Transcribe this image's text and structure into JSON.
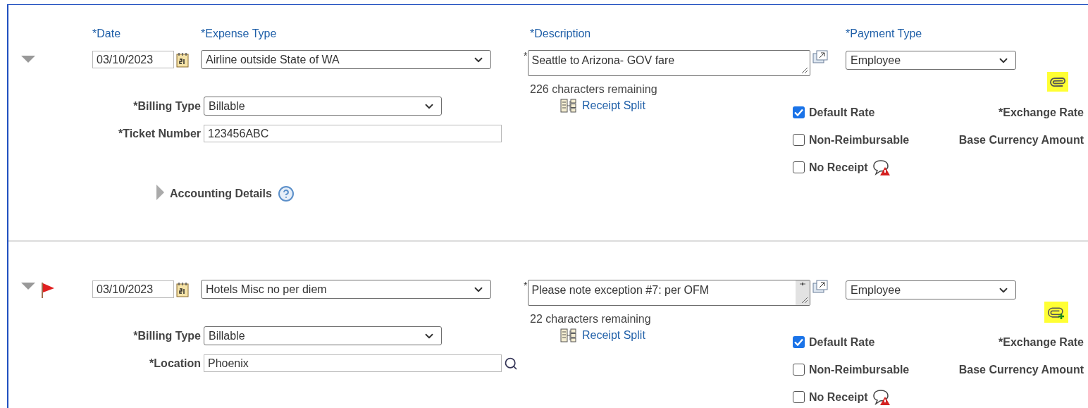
{
  "entries": [
    {
      "expanded": true,
      "flagged": false,
      "labels": {
        "date": "*Date",
        "expense_type": "*Expense Type",
        "description": "*Description",
        "payment_type": "*Payment Type"
      },
      "date": "03/10/2023",
      "expense_type": "Airline outside State of WA",
      "description_marker": "*",
      "description": "Seattle to Arizona- GOV fare",
      "description_scrollbar": false,
      "payment_type": "Employee",
      "attachment": {
        "kind": "attached"
      },
      "chars_remaining": "226 characters remaining",
      "receipt_split": "Receipt Split",
      "fields": [
        {
          "kind": "select",
          "label": "*Billing Type",
          "value": "Billable"
        },
        {
          "kind": "text",
          "label": "*Ticket Number",
          "value": "123456ABC"
        }
      ],
      "accounting_details": {
        "label": "Accounting Details",
        "expanded": false
      },
      "checkboxes": [
        {
          "label": "Default Rate",
          "checked": true,
          "side_label": "*Exchange Rate"
        },
        {
          "label": "Non-Reimbursable",
          "checked": false,
          "side_label": "Base Currency Amount"
        },
        {
          "label": "No Receipt",
          "checked": false,
          "warning": true
        }
      ]
    },
    {
      "expanded": true,
      "flagged": true,
      "date": "03/10/2023",
      "expense_type": "Hotels Misc no per diem",
      "description_marker": "*",
      "description": "Please note exception #7: per OFM",
      "description_scrollbar": true,
      "payment_type": "Employee",
      "attachment": {
        "kind": "add"
      },
      "chars_remaining": "22 characters remaining",
      "receipt_split": "Receipt Split",
      "fields": [
        {
          "kind": "select",
          "label": "*Billing Type",
          "value": "Billable"
        },
        {
          "kind": "lookup",
          "label": "*Location",
          "value": "Phoenix"
        }
      ],
      "checkboxes": [
        {
          "label": "Default Rate",
          "checked": true,
          "side_label": "*Exchange Rate"
        },
        {
          "label": "Non-Reimbursable",
          "checked": false,
          "side_label": "Base Currency Amount"
        },
        {
          "label": "No Receipt",
          "checked": false,
          "warning": true
        }
      ]
    }
  ]
}
